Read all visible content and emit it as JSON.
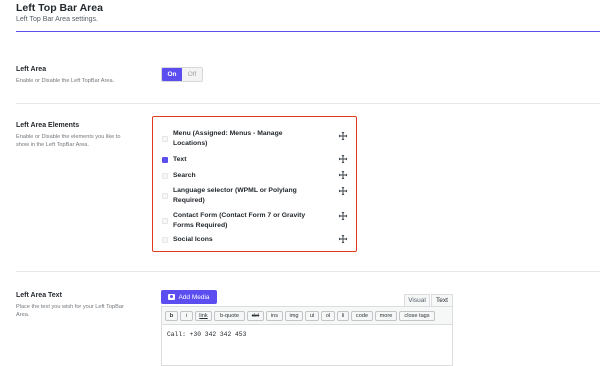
{
  "header": {
    "title": "Left Top Bar Area",
    "subtitle": "Left Top Bar Area settings."
  },
  "left_area": {
    "title": "Left Area",
    "description": "Enable or Disable the Left TopBar Area.",
    "toggle": {
      "on_label": "On",
      "off_label": "Off",
      "value": "On"
    }
  },
  "left_area_elements": {
    "title": "Left Area Elements",
    "description": "Enable or Disable the elements you like to show in the Left TopBar Area.",
    "items": [
      {
        "label": "Menu (Assigned: Menus - Manage Locations)",
        "checked": false,
        "icon": "move-icon"
      },
      {
        "label": "Text",
        "checked": true,
        "icon": "move-icon"
      },
      {
        "label": "Search",
        "checked": false,
        "icon": "move-icon"
      },
      {
        "label": "Language selector (WPML or Polylang Required)",
        "checked": false,
        "icon": "move-icon"
      },
      {
        "label": "Contact Form (Contact Form 7 or Gravity Forms Required)",
        "checked": false,
        "icon": "move-icon"
      },
      {
        "label": "Social Icons",
        "checked": false,
        "icon": "move-icon"
      }
    ]
  },
  "left_area_text": {
    "title": "Left Area Text",
    "description": "Place the text you wish for your Left TopBar Area.",
    "add_media_label": "Add Media",
    "tabs": [
      "Visual",
      "Text"
    ],
    "active_tab": "Text",
    "toolbar": [
      "b",
      "i",
      "link",
      "b-quote",
      "del",
      "ins",
      "img",
      "ul",
      "ol",
      "li",
      "code",
      "more",
      "close tags"
    ],
    "content": "Call: +30 342 342 453"
  },
  "colors": {
    "accent": "#5b4df0",
    "highlight_border": "#e03a1e"
  }
}
